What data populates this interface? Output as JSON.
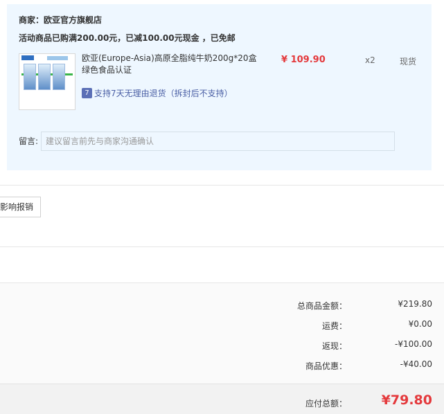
{
  "shop": {
    "label": "商家：欧亚官方旗舰店"
  },
  "promo": {
    "text": "活动商品已购满200.00元，已减100.00元现金 ，已免邮"
  },
  "product": {
    "title": "欧亚(Europe-Asia)高原全脂纯牛奶200g*20盒 绿色食品认证",
    "price": "¥ 109.90",
    "quantity": "x2",
    "stock_status": "现货",
    "return_icon_text": "7",
    "return_policy": "支持7天无理由退货（拆封后不支持）"
  },
  "note": {
    "label": "留言:",
    "placeholder": "建议留言前先与商家沟通确认"
  },
  "invoice": {
    "button_label": "影响报销"
  },
  "summary": {
    "rows": [
      {
        "label": "总商品金额：",
        "value": "¥219.80"
      },
      {
        "label": "运费：",
        "value": "¥0.00"
      },
      {
        "label": "返现：",
        "value": "-¥100.00"
      },
      {
        "label": "商品优惠：",
        "value": "-¥40.00"
      }
    ],
    "total_label": "应付总额：",
    "total_value": "¥79.80"
  },
  "colors": {
    "accent_red": "#e4393c",
    "card_bg": "#eef7ff",
    "return_blue": "#4a5fa5"
  },
  "icons": {
    "return": "seven-day-return-icon"
  }
}
